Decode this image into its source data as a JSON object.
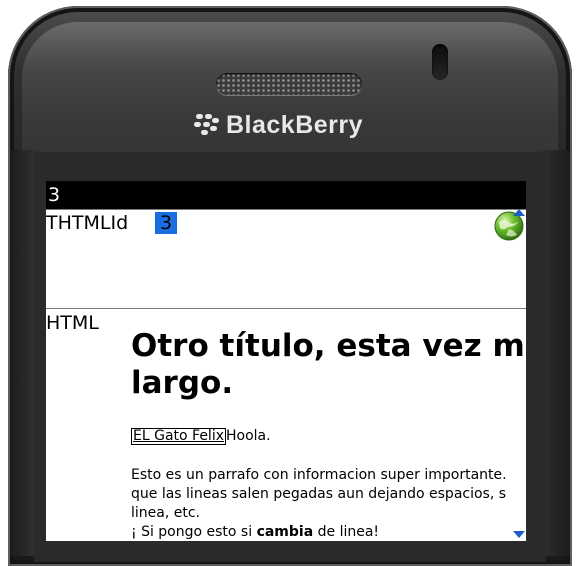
{
  "device": {
    "brand": "BlackBerry"
  },
  "screen": {
    "title_bar": "3",
    "field": {
      "label": "THTMLId",
      "value": "3"
    },
    "html_field": {
      "label": "HTML",
      "heading_line1": "Otro título, esta vez más",
      "heading_line2": "largo.",
      "link_text": "EL Gato Felix",
      "link_suffix": "Hoola.",
      "paragraph": {
        "line1": "Esto es un parrafo con informacion super importante.",
        "line2": "que las lineas salen pegadas aun dejando espacios, s",
        "line3": "linea, etc.",
        "line4_before": "¡ Si pongo esto si ",
        "line4_bold": "cambia",
        "line4_after": " de linea!"
      }
    },
    "icons": {
      "globe": "globe-icon",
      "scroll_up": "scroll-up-arrow-icon",
      "scroll_down": "scroll-down-arrow-icon"
    },
    "colors": {
      "title_bar_bg": "#000000",
      "selected_value_bg": "#1a6fe0",
      "scroll_arrow": "#1f5fc4"
    }
  }
}
